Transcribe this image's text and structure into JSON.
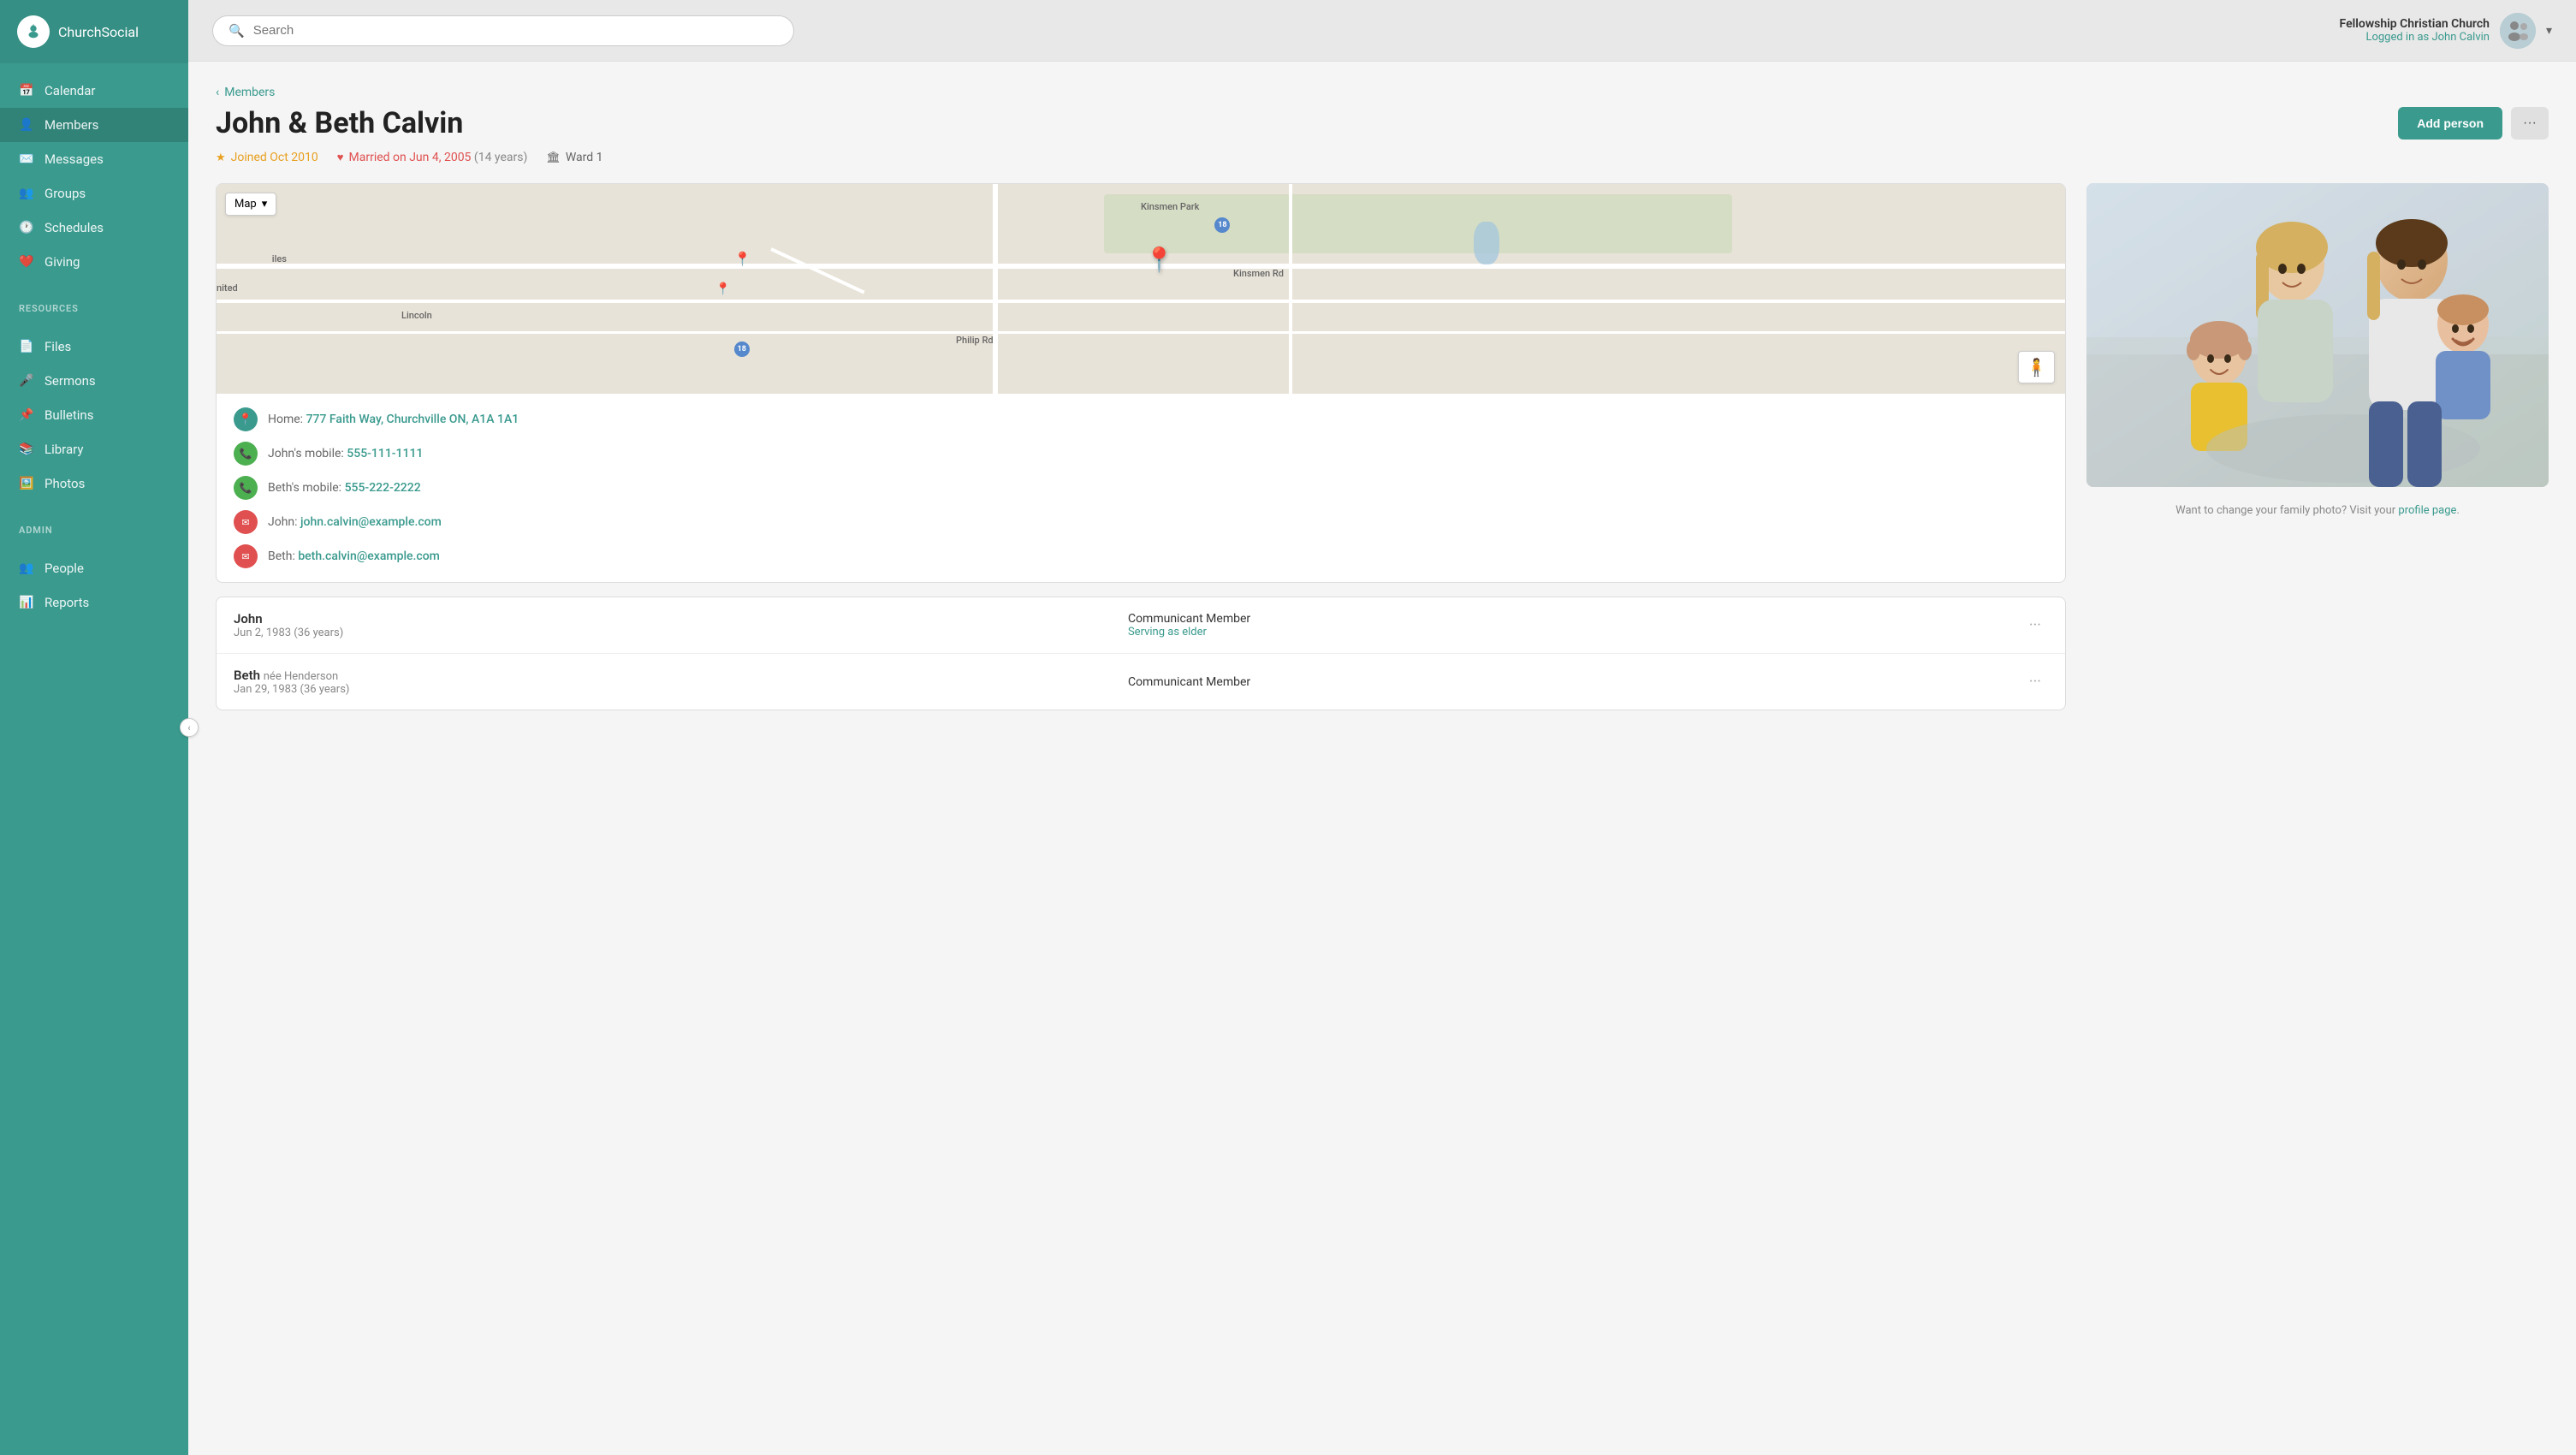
{
  "app": {
    "name": "ChurchSocial"
  },
  "header": {
    "search_placeholder": "Search",
    "church_name": "Fellowship Christian Church",
    "logged_in_as": "Logged in as John Calvin"
  },
  "sidebar": {
    "nav_items": [
      {
        "id": "calendar",
        "label": "Calendar",
        "icon": "📅"
      },
      {
        "id": "members",
        "label": "Members",
        "icon": "👤"
      },
      {
        "id": "messages",
        "label": "Messages",
        "icon": "✉️"
      },
      {
        "id": "groups",
        "label": "Groups",
        "icon": "👥"
      },
      {
        "id": "schedules",
        "label": "Schedules",
        "icon": "🕐"
      },
      {
        "id": "giving",
        "label": "Giving",
        "icon": "❤️"
      }
    ],
    "resources_label": "RESOURCES",
    "resources_items": [
      {
        "id": "files",
        "label": "Files",
        "icon": "📄"
      },
      {
        "id": "sermons",
        "label": "Sermons",
        "icon": "🎤"
      },
      {
        "id": "bulletins",
        "label": "Bulletins",
        "icon": "📌"
      },
      {
        "id": "library",
        "label": "Library",
        "icon": "📚"
      },
      {
        "id": "photos",
        "label": "Photos",
        "icon": "🖼️"
      }
    ],
    "admin_label": "ADMIN",
    "admin_items": [
      {
        "id": "people",
        "label": "People",
        "icon": "👥"
      },
      {
        "id": "reports",
        "label": "Reports",
        "icon": "📊"
      }
    ]
  },
  "breadcrumb": {
    "label": "Members"
  },
  "person": {
    "title": "John & Beth Calvin",
    "joined": "Joined Oct 2010",
    "married": "Married on Jun 4, 2005",
    "married_years": "(14 years)",
    "ward": "Ward 1",
    "address": "777 Faith Way, Churchville ON, A1A 1A1",
    "address_label": "Home:",
    "john_phone": "555-111-1111",
    "john_phone_label": "John's mobile:",
    "beth_phone": "555-222-2222",
    "beth_phone_label": "Beth's mobile:",
    "john_email": "john.calvin@example.com",
    "john_email_label": "John:",
    "beth_email": "beth.calvin@example.com",
    "beth_email_label": "Beth:"
  },
  "members_list": [
    {
      "name": "John",
      "née": "",
      "dob": "Jun 2, 1983 (36 years)",
      "status": "Communicant Member",
      "role": "Serving as elder"
    },
    {
      "name": "Beth",
      "née": "née Henderson",
      "dob": "Jan 29, 1983 (36 years)",
      "status": "Communicant Member",
      "role": ""
    }
  ],
  "photo_caption": "Want to change your family photo? Visit your",
  "photo_caption_link": "profile page",
  "buttons": {
    "add_person": "Add person",
    "more": "···",
    "map_type": "Map"
  },
  "colors": {
    "brand": "#3a9a8e",
    "sidebar_bg": "#3a9a8e",
    "accent_joined": "#e8a020",
    "accent_married": "#e05050"
  }
}
